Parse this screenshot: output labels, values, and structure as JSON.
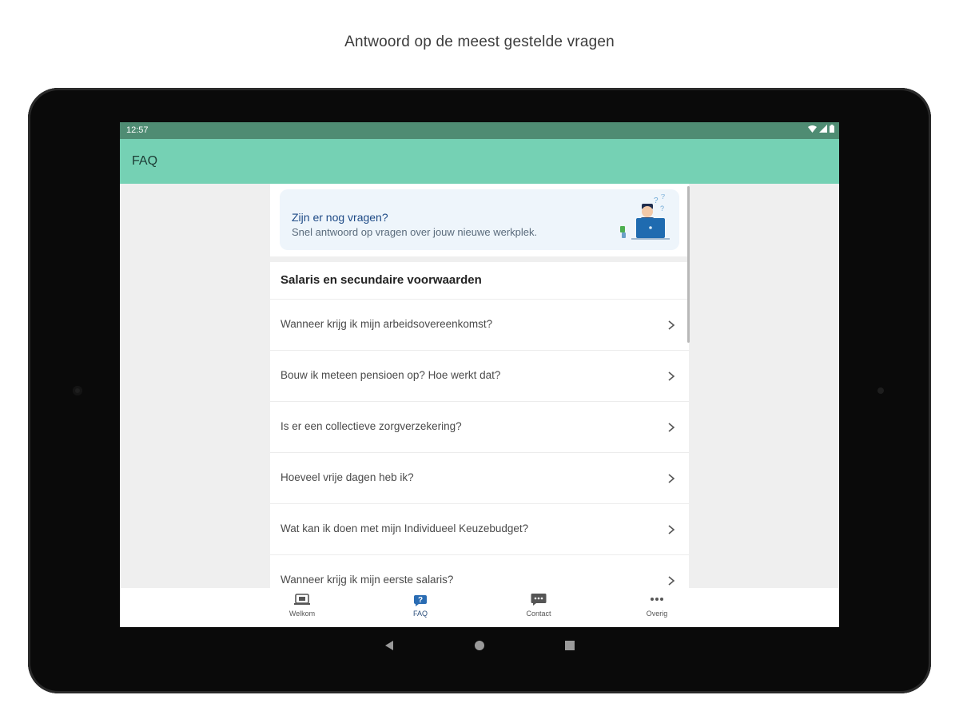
{
  "caption": "Antwoord op de meest gestelde vragen",
  "statusbar": {
    "time": "12:57"
  },
  "appbar": {
    "title": "FAQ"
  },
  "banner": {
    "title": "Zijn er nog vragen?",
    "subtitle": "Snel antwoord op vragen over jouw nieuwe werkplek."
  },
  "section": {
    "title": "Salaris en secundaire voorwaarden"
  },
  "questions": [
    {
      "label": "Wanneer krijg ik mijn arbeidsovereenkomst?"
    },
    {
      "label": "Bouw ik meteen pensioen op? Hoe werkt dat?"
    },
    {
      "label": "Is er een collectieve zorgverzekering?"
    },
    {
      "label": "Hoeveel vrije dagen heb ik?"
    },
    {
      "label": "Wat kan ik doen met mijn Individueel Keuzebudget?"
    },
    {
      "label": "Wanneer krijg ik mijn eerste salaris?"
    }
  ],
  "nav": [
    {
      "label": "Welkom",
      "icon": "welcome-icon"
    },
    {
      "label": "FAQ",
      "icon": "faq-icon",
      "active": true
    },
    {
      "label": "Contact",
      "icon": "chat-icon"
    },
    {
      "label": "Overig",
      "icon": "more-icon"
    }
  ],
  "colors": {
    "statusbar": "#4f8c73",
    "appbar": "#75d1b4",
    "accent": "#1e4a86",
    "banner_bg": "#eef5fb"
  }
}
